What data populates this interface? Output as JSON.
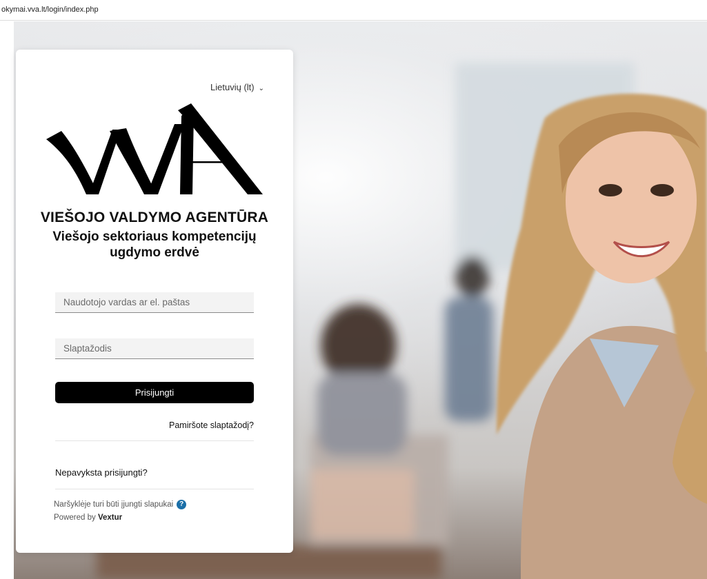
{
  "browser": {
    "url": "okymai.vva.lt/login/index.php"
  },
  "login": {
    "language": "Lietuvių (lt)",
    "org_name": "VIEŠOJO VALDYMO AGENTŪRA",
    "tagline": "Viešojo sektoriaus kompetencijų ugdymo erdvė",
    "username_placeholder": "Naudotojo vardas ar el. paštas",
    "password_placeholder": "Slaptažodis",
    "login_button": "Prisijungti",
    "forgot_link": "Pamiršote slaptažodį?",
    "trouble_text": "Nepavyksta prisijungti?",
    "cookies_note": "Naršyklėje turi būti įjungti slapukai",
    "help_icon": "?",
    "powered_by_prefix": "Powered by",
    "powered_by_brand": "Vextur"
  },
  "icons": {
    "language_chevron": "chevron-down-icon",
    "help": "question-circle-icon"
  },
  "colors": {
    "button_bg": "#000000",
    "help_badge": "#1b6fa8",
    "card_bg": "#ffffff"
  }
}
